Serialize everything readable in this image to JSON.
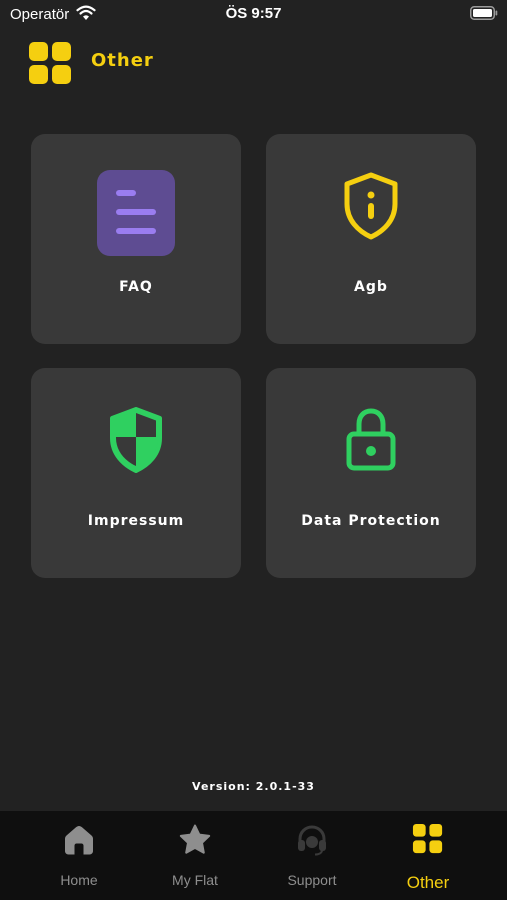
{
  "status_bar": {
    "carrier": "Operatör",
    "time": "ÖS 9:57"
  },
  "header": {
    "title": "Other",
    "icon": "grid-icon"
  },
  "cards": [
    {
      "label": "FAQ",
      "icon": "faq-document-icon"
    },
    {
      "label": "Agb",
      "icon": "shield-info-icon"
    },
    {
      "label": "Impressum",
      "icon": "shield-check-icon"
    },
    {
      "label": "Data Protection",
      "icon": "lock-icon"
    }
  ],
  "version": "Version: 2.0.1-33",
  "tab_bar": {
    "tabs": [
      {
        "label": "Home",
        "icon": "home-icon"
      },
      {
        "label": "My Flat",
        "icon": "star-icon"
      },
      {
        "label": "Support",
        "icon": "headset-icon"
      },
      {
        "label": "Other",
        "icon": "grid-icon",
        "active": true
      }
    ]
  },
  "colors": {
    "background": "#222222",
    "card": "#393939",
    "accent": "#f5cf10",
    "green": "#2fd060",
    "purple": "#7a5fc0",
    "tab_bar": "#0f0f0f",
    "tab_inactive": "#8e8e8e"
  }
}
